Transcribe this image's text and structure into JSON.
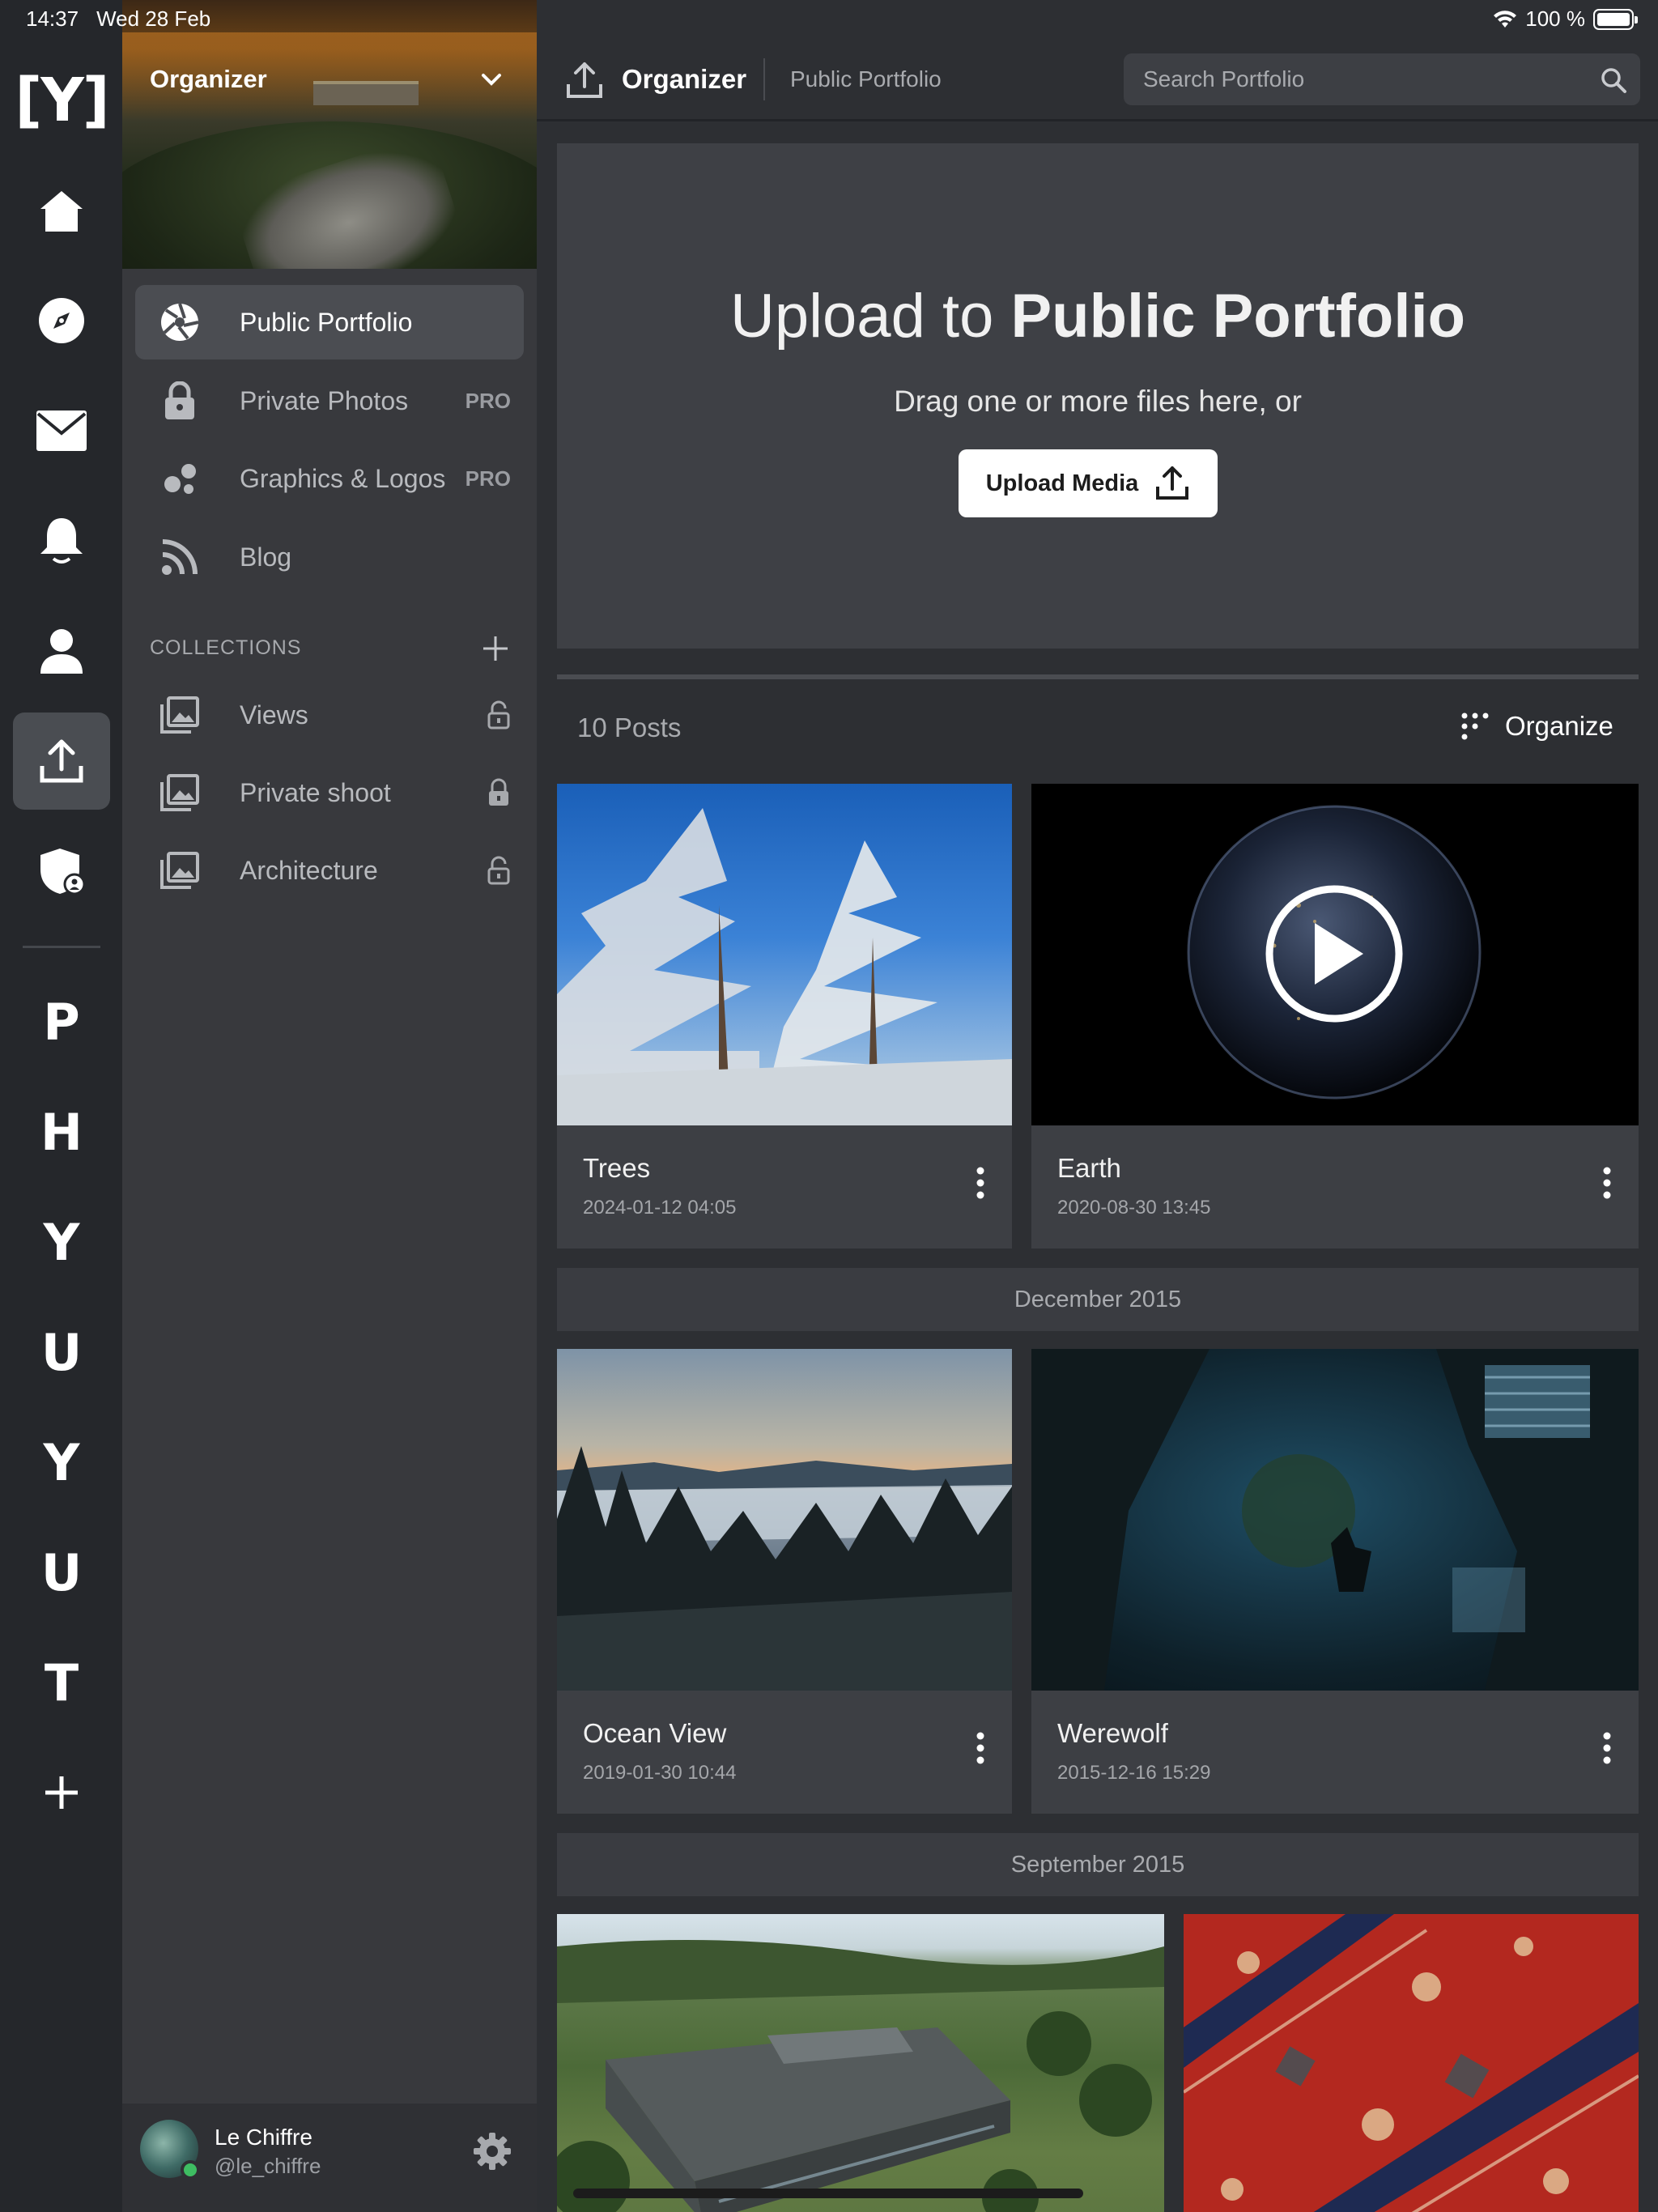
{
  "status_bar": {
    "time": "14:37",
    "date": "Wed 28 Feb",
    "battery": "100 %"
  },
  "rail": {
    "logo": "[Y]",
    "letters": [
      "P",
      "H",
      "Y",
      "U",
      "Y",
      "U",
      "T"
    ]
  },
  "sidebar": {
    "header_title": "Organizer",
    "items": [
      {
        "label": "Public Portfolio",
        "badge": ""
      },
      {
        "label": "Private Photos",
        "badge": "PRO"
      },
      {
        "label": "Graphics & Logos",
        "badge": "PRO"
      },
      {
        "label": "Blog",
        "badge": ""
      }
    ],
    "collections_heading": "COLLECTIONS",
    "collections": [
      {
        "label": "Views"
      },
      {
        "label": "Private shoot"
      },
      {
        "label": "Architecture"
      }
    ],
    "user": {
      "name": "Le Chiffre",
      "handle": "@le_chiffre"
    }
  },
  "topbar": {
    "title": "Organizer",
    "subtitle": "Public Portfolio",
    "search_placeholder": "Search Portfolio"
  },
  "upload": {
    "title_prefix": "Upload to ",
    "title_bold": "Public Portfolio",
    "subtitle": "Drag one or more files here, or",
    "button_label": "Upload Media"
  },
  "posts": {
    "count_label": "10 Posts",
    "organize_label": "Organize",
    "cards": [
      {
        "title": "Trees",
        "date": "2024-01-12 04:05"
      },
      {
        "title": "Earth",
        "date": "2020-08-30 13:45"
      },
      {
        "title": "Ocean View",
        "date": "2019-01-30 10:44"
      },
      {
        "title": "Werewolf",
        "date": "2015-12-16 15:29"
      }
    ],
    "sections": [
      "December 2015",
      "September 2015"
    ]
  },
  "colors": {
    "rail_bg": "#25272b",
    "sidebar_bg": "#38393d",
    "main_bg": "#2d2f33",
    "card_bg": "#3d3f44",
    "accent_white": "#ffffff",
    "online": "#3ebd62"
  }
}
